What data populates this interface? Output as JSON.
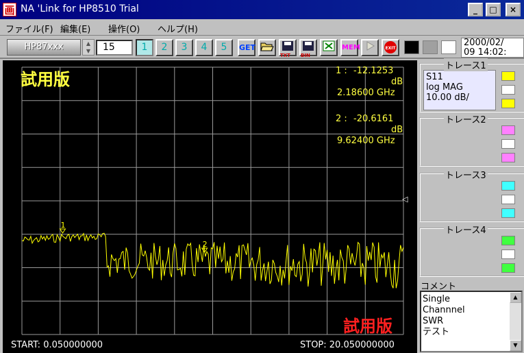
{
  "window": {
    "title": "NA 'Link for HP8510 Trial",
    "app_icon_glyph": "画",
    "controls": {
      "minimize": "_",
      "maximize": "□",
      "close": "×"
    }
  },
  "menu": [
    "ファイル(F)",
    "編集(E)",
    "操作(O)",
    "ヘルプ(H)"
  ],
  "toolbar": {
    "model_button": "HP87xxx",
    "average_value": "15",
    "channel_buttons": [
      "1",
      "2",
      "3",
      "4",
      "5"
    ],
    "get_label": "GET",
    "txt_label": "TXT",
    "bin_label": "BIN",
    "mem_label": "MEM",
    "exit_label": "EXIT",
    "datetime_line1": "2000/02/",
    "datetime_line2": "09 14:02:"
  },
  "graph": {
    "watermark_top": "試用版",
    "watermark_bottom": "試用版",
    "marker1": {
      "label": "1 :",
      "value": "-12.1253",
      "unit": "dB",
      "freq": "2.18600 GHz"
    },
    "marker2": {
      "label": "2 :",
      "value": "-20.6161",
      "unit": "dB",
      "freq": "9.62400 GHz"
    },
    "start_label": "START: 0.050000000",
    "stop_label": "STOP: 20.050000000",
    "ref_marker_glyph": "◁"
  },
  "traces": [
    {
      "title": "トレース1",
      "lines": [
        "S11",
        "log MAG",
        "10.00 dB/"
      ],
      "colors": [
        "#ffff00",
        "#ffffff",
        "#ffff00"
      ]
    },
    {
      "title": "トレース2",
      "lines": [],
      "colors": [
        "#ff80ff",
        "#ffffff",
        "#ff80ff"
      ]
    },
    {
      "title": "トレース3",
      "lines": [],
      "colors": [
        "#40ffff",
        "#ffffff",
        "#40ffff"
      ]
    },
    {
      "title": "トレース4",
      "lines": [],
      "colors": [
        "#40ff40",
        "#ffffff",
        "#40ff40"
      ]
    }
  ],
  "comment": {
    "label": "コメント",
    "lines": [
      "Single",
      "Channnel",
      "SWR",
      "テスト"
    ]
  },
  "chart_data": {
    "type": "line",
    "xlabel": "",
    "ylabel": "",
    "x_start": 0.05,
    "x_stop": 20.05,
    "trace_color": "#ffff00",
    "grid": true,
    "markers": [
      {
        "id": "1",
        "x": 2.186,
        "y": -12.1253
      },
      {
        "id": "2",
        "x": 9.624,
        "y": -20.6161
      }
    ]
  }
}
